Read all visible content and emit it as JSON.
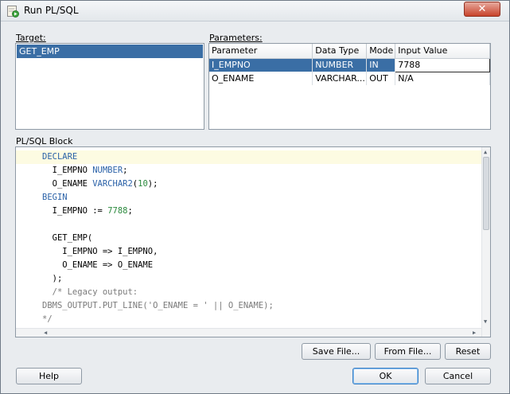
{
  "window": {
    "title": "Run PL/SQL",
    "close_label": "✕"
  },
  "target": {
    "label": "Target:",
    "items": [
      "GET_EMP"
    ]
  },
  "parameters": {
    "label": "Parameters:",
    "columns": [
      "Parameter",
      "Data Type",
      "Mode",
      "Input Value"
    ],
    "rows": [
      {
        "parameter": "I_EMPNO",
        "data_type": "NUMBER",
        "mode": "IN",
        "input_value": "7788"
      },
      {
        "parameter": "O_ENAME",
        "data_type": "VARCHAR...",
        "mode": "OUT",
        "input_value": "N/A"
      }
    ]
  },
  "plsql": {
    "label": "PL/SQL Block",
    "lines": [
      "DECLARE",
      "  I_EMPNO NUMBER;",
      "  O_ENAME VARCHAR2(10);",
      "BEGIN",
      "  I_EMPNO := 7788;",
      "",
      "  GET_EMP(",
      "    I_EMPNO => I_EMPNO,",
      "    O_ENAME => O_ENAME",
      "  );",
      "  /* Legacy output:",
      "DBMS_OUTPUT.PUT_LINE('O_ENAME = ' || O_ENAME);",
      "*/"
    ]
  },
  "buttons": {
    "save_file": "Save File...",
    "from_file": "From File...",
    "reset": "Reset",
    "help": "Help",
    "ok": "OK",
    "cancel": "Cancel"
  },
  "colors": {
    "selection": "#3a6ea5",
    "keyword": "#2b62a8",
    "number": "#2c8a3e",
    "comment": "#7a7a7a"
  }
}
